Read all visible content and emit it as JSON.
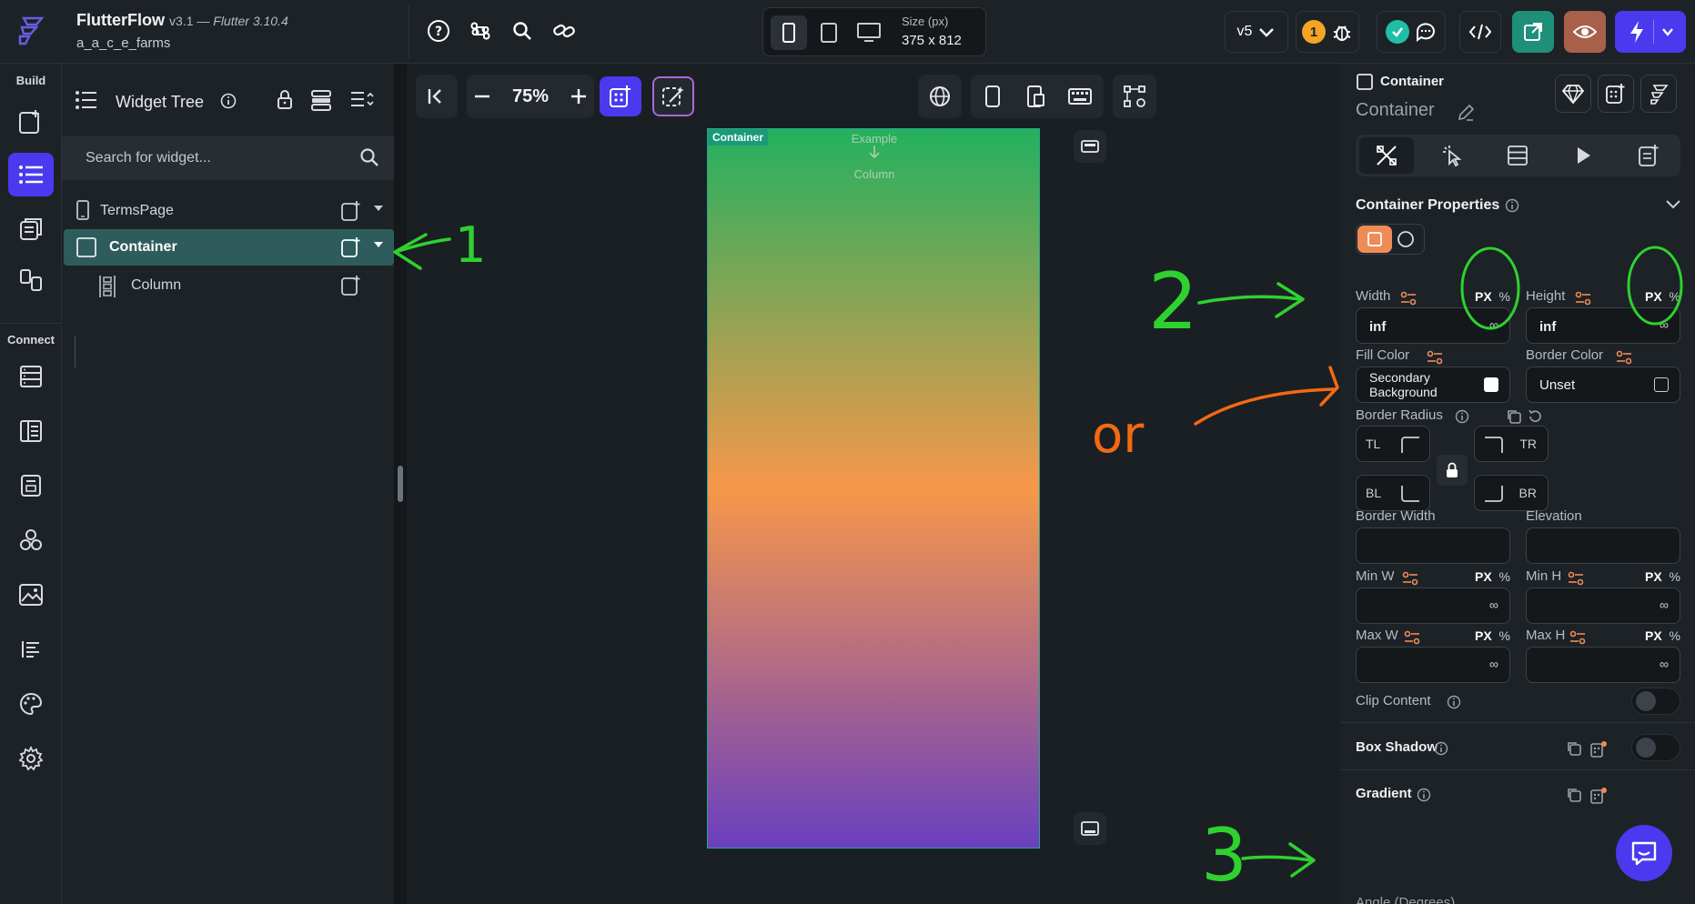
{
  "header": {
    "app_name": "FlutterFlow",
    "version": "v3.1",
    "flutter_version": "Flutter 3.10.4",
    "project": "a_a_c_e_farms",
    "size_label": "Size (px)",
    "size_value": "375 x 812",
    "version_selector": "v5",
    "notifications_count": "1"
  },
  "rail": {
    "build_label": "Build",
    "connect_label": "Connect"
  },
  "widget_tree": {
    "title": "Widget Tree",
    "search_placeholder": "Search for widget...",
    "items": [
      {
        "label": "TermsPage"
      },
      {
        "label": "Container"
      },
      {
        "label": "Column"
      }
    ]
  },
  "canvas": {
    "zoom": "75%",
    "container_tag": "Container",
    "hint_top": "Example",
    "hint_bottom": "Column"
  },
  "properties": {
    "widget_type": "Container",
    "widget_name": "Container",
    "section_title": "Container Properties",
    "width_label": "Width",
    "height_label": "Height",
    "unit_px": "PX",
    "unit_pct": "%",
    "width_value": "inf",
    "height_value": "inf",
    "inf_symbol": "∞",
    "fill_color_label": "Fill Color",
    "fill_color_value": "Secondary Background",
    "border_color_label": "Border Color",
    "border_color_value": "Unset",
    "border_radius_label": "Border Radius",
    "tl": "TL",
    "tr": "TR",
    "bl": "BL",
    "br": "BR",
    "border_width_label": "Border Width",
    "elevation_label": "Elevation",
    "min_w_label": "Min W",
    "min_h_label": "Min H",
    "max_w_label": "Max W",
    "max_h_label": "Max H",
    "clip_content_label": "Clip Content",
    "box_shadow_label": "Box Shadow",
    "gradient_label": "Gradient",
    "angle_label": "Angle (Degrees)"
  },
  "annotations": {
    "n1": "1",
    "n2": "2",
    "n3": "3",
    "or": "or",
    "color_green": "#2fd12f",
    "color_orange": "#f26a11"
  }
}
